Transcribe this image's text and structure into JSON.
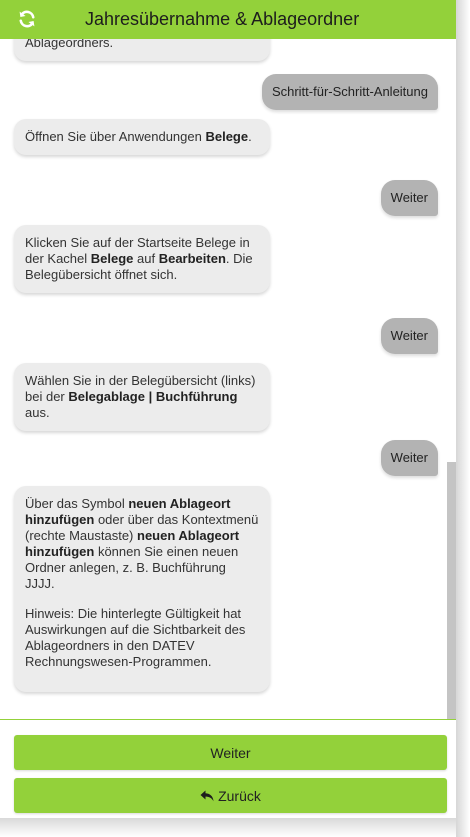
{
  "header": {
    "title": "Jahresübernahme & Ablageordner",
    "refresh_icon": "refresh-icon"
  },
  "colors": {
    "brand_green": "#93d13a",
    "bot_bubble": "#ececec",
    "user_bubble": "#b3b3b3"
  },
  "messages": [
    {
      "type": "bot",
      "parts": [
        {
          "text": "Ablageordners."
        }
      ]
    },
    {
      "type": "user",
      "text": "Schritt-für-Schritt-Anleitung"
    },
    {
      "type": "bot",
      "parts": [
        {
          "text": "Öffnen Sie über Anwendungen "
        },
        {
          "bold": "Belege"
        },
        {
          "text": "."
        }
      ]
    },
    {
      "type": "user",
      "text": "Weiter"
    },
    {
      "type": "bot",
      "parts": [
        {
          "text": "Klicken Sie auf der Startseite Belege in der Kachel "
        },
        {
          "bold": "Belege"
        },
        {
          "text": " auf "
        },
        {
          "bold": "Bearbeiten"
        },
        {
          "text": ". Die Belegübersicht öffnet sich."
        }
      ]
    },
    {
      "type": "user",
      "text": "Weiter"
    },
    {
      "type": "bot",
      "parts": [
        {
          "text": "Wählen Sie in der Belegübersicht (links) bei der "
        },
        {
          "bold": "Belegablage | Buchführung"
        },
        {
          "text": " aus."
        }
      ]
    },
    {
      "type": "user",
      "text": "Weiter"
    },
    {
      "type": "bot",
      "paragraphs": [
        [
          {
            "text": "Über das Symbol "
          },
          {
            "bold": "neuen Ablageort hinzufügen"
          },
          {
            "text": " oder über das Kontextmenü (rechte Maustaste) "
          },
          {
            "bold": "neuen Ablageort hinzufügen"
          },
          {
            "text": " können Sie einen neuen Ordner anlegen, z. B. Buchführung JJJJ."
          }
        ],
        [
          {
            "text": "Hinweis: Die hinterlegte Gültigkeit hat Auswirkungen auf die Sichtbarkeit des Ablageordners in den DATEV Rechnungswesen-Programmen."
          }
        ]
      ]
    }
  ],
  "footer": {
    "next_label": "Weiter",
    "back_label": "Zurück",
    "back_icon": "reply-arrow-icon"
  }
}
